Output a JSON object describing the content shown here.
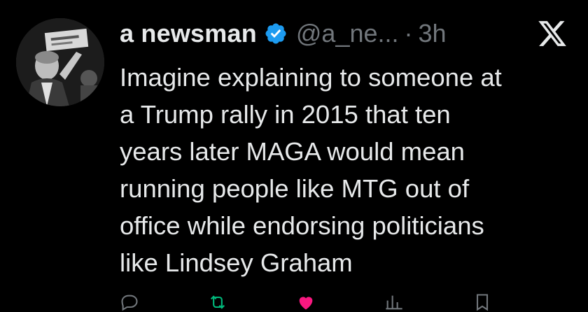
{
  "tweet": {
    "author_name": "a newsman",
    "handle": "@a_ne...",
    "separator": "·",
    "time": "3h",
    "text_lines": [
      "Imagine explaining to someone at",
      "a Trump rally in 2015 that ten",
      "years later MAGA would mean",
      "running people like MTG out of",
      "office while endorsing politicians",
      "like Lindsey Graham"
    ]
  },
  "icons": {
    "verified": "verified-badge-icon",
    "platform": "x-logo-icon"
  },
  "colors": {
    "background": "#000000",
    "text": "#e7e9ea",
    "secondary": "#71767b",
    "verified": "#1d9bf0"
  }
}
